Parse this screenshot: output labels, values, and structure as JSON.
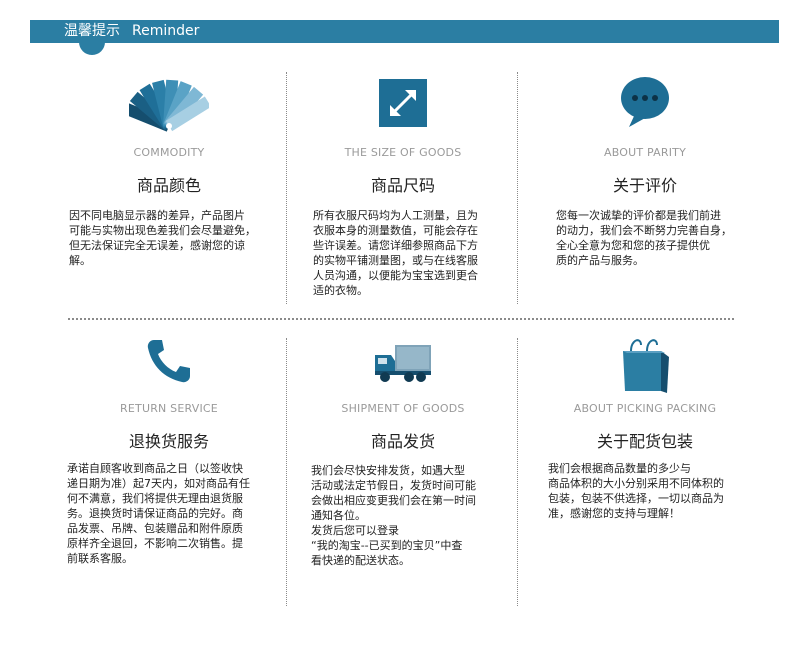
{
  "header": {
    "title_cn": "温馨提示",
    "title_en": "Reminder"
  },
  "items": [
    {
      "icon": "color-fan-icon",
      "eng": "COMMODITY",
      "cn": "商品颜色",
      "desc": "因不同电脑显示器的差异，产品图片\n可能与实物出现色差我们会尽量避免，\n但无法保证完全无误差，感谢您的谅\n解。"
    },
    {
      "icon": "resize-arrow-icon",
      "eng": "THE SIZE OF GOODS",
      "cn": "商品尺码",
      "desc": "所有衣服尺码均为人工测量，且为\n衣服本身的测量数值，可能会存在\n些许误差。请您详细参照商品下方\n的实物平铺测量图，或与在线客服\n人员沟通，以便能为宝宝选到更合\n适的衣物。"
    },
    {
      "icon": "speech-bubble-icon",
      "eng": "ABOUT PARITY",
      "cn": "关于评价",
      "desc": "您每一次诚挚的评价都是我们前进\n的动力，我们会不断努力完善自身，\n全心全意为您和您的孩子提供优\n质的产品与服务。"
    },
    {
      "icon": "phone-icon",
      "eng": "RETURN SERVICE",
      "cn": "退换货服务",
      "desc": "承诺自顾客收到商品之日（以签收快\n递日期为准）起7天内，如对商品有任\n何不满意，我们将提供无理由退货服\n务。退换货时请保证商品的完好。商\n品发票、吊牌、包装赠品和附件原质\n原样齐全退回，不影响二次销售。提\n前联系客服。"
    },
    {
      "icon": "truck-icon",
      "eng": "SHIPMENT OF GOODS",
      "cn": "商品发货",
      "desc": " 我们会尽快安排发货，如遇大型\n活动或法定节假日，发货时间可能\n会做出相应变更我们会在第一时间\n通知各位。\n发货后您可以登录\n “我的淘宝--已买到的宝贝”中查\n看快递的配送状态。"
    },
    {
      "icon": "shopping-bag-icon",
      "eng": "ABOUT PICKING PACKING",
      "cn": "关于配货包装",
      "desc": "          我们会根据商品数量的多少与\n商品体积的大小分别采用不同体积的\n包装，包装不供选择，一切以商品为\n准，感谢您的支持与理解！"
    }
  ],
  "colors": {
    "accent": "#2b7ea3",
    "icon": "#1e6e95",
    "divider": "#8a8a8a"
  }
}
